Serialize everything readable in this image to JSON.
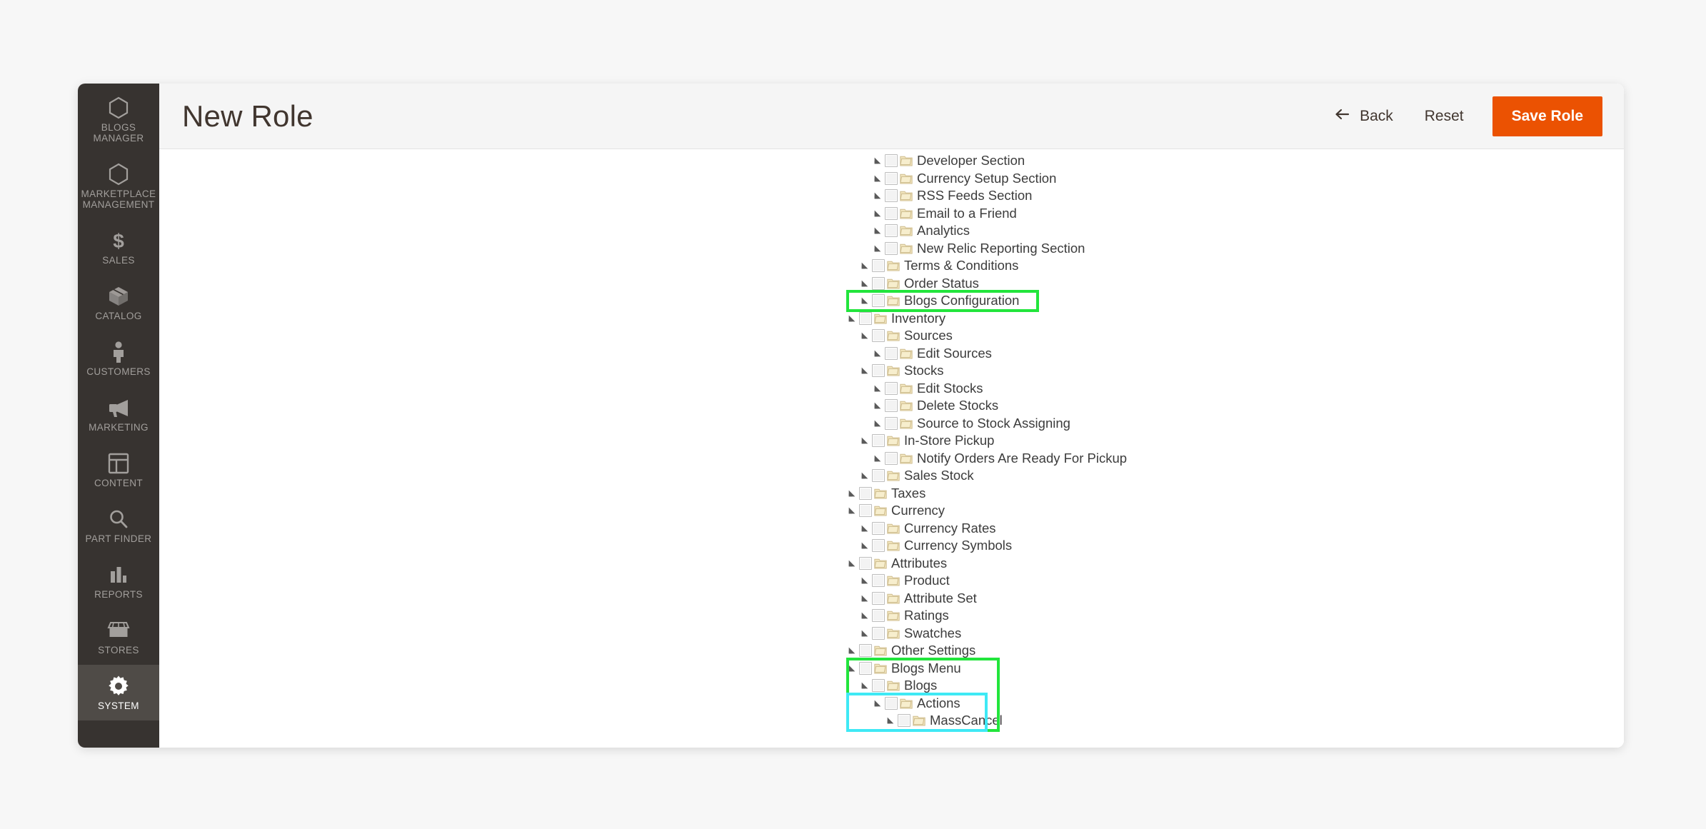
{
  "app": {
    "background_color": "#f7f7f7",
    "accent_color": "#eb5202",
    "sidebar_color": "#373330",
    "highlight_primary_color": "#22e53c",
    "highlight_secondary_color": "#3fe9f5"
  },
  "sidebar": {
    "items": [
      {
        "label": "BLOGS\nMANAGER",
        "icon": "hexagon-icon",
        "active": false
      },
      {
        "label": "MARKETPLACE\nMANAGEMENT",
        "icon": "hexagon-icon",
        "active": false
      },
      {
        "label": "SALES",
        "icon": "dollar-icon",
        "active": false
      },
      {
        "label": "CATALOG",
        "icon": "box-icon",
        "active": false
      },
      {
        "label": "CUSTOMERS",
        "icon": "person-icon",
        "active": false
      },
      {
        "label": "MARKETING",
        "icon": "megaphone-icon",
        "active": false
      },
      {
        "label": "CONTENT",
        "icon": "layout-icon",
        "active": false
      },
      {
        "label": "PART FINDER",
        "icon": "search-icon",
        "active": false
      },
      {
        "label": "REPORTS",
        "icon": "bar-chart-icon",
        "active": false
      },
      {
        "label": "STORES",
        "icon": "storefront-icon",
        "active": false
      },
      {
        "label": "SYSTEM",
        "icon": "gear-icon",
        "active": true
      }
    ]
  },
  "header": {
    "title": "New Role",
    "back_label": "Back",
    "back_icon": "arrow-left-icon",
    "reset_label": "Reset",
    "save_label": "Save Role"
  },
  "tree": {
    "nodes": [
      {
        "label": "Developer Section",
        "level": 3
      },
      {
        "label": "Currency Setup Section",
        "level": 3
      },
      {
        "label": "RSS Feeds Section",
        "level": 3
      },
      {
        "label": "Email to a Friend",
        "level": 3
      },
      {
        "label": "Analytics",
        "level": 3
      },
      {
        "label": "New Relic Reporting Section",
        "level": 3
      },
      {
        "label": "Terms & Conditions",
        "level": 2
      },
      {
        "label": "Order Status",
        "level": 2
      },
      {
        "label": "Blogs Configuration",
        "level": 2
      },
      {
        "label": "Inventory",
        "level": 1
      },
      {
        "label": "Sources",
        "level": 2
      },
      {
        "label": "Edit Sources",
        "level": 3
      },
      {
        "label": "Stocks",
        "level": 2
      },
      {
        "label": "Edit Stocks",
        "level": 3
      },
      {
        "label": "Delete Stocks",
        "level": 3
      },
      {
        "label": "Source to Stock Assigning",
        "level": 3
      },
      {
        "label": "In-Store Pickup",
        "level": 2
      },
      {
        "label": "Notify Orders Are Ready For Pickup",
        "level": 3
      },
      {
        "label": "Sales Stock",
        "level": 2
      },
      {
        "label": "Taxes",
        "level": 1
      },
      {
        "label": "Currency",
        "level": 1
      },
      {
        "label": "Currency Rates",
        "level": 2
      },
      {
        "label": "Currency Symbols",
        "level": 2
      },
      {
        "label": "Attributes",
        "level": 1
      },
      {
        "label": "Product",
        "level": 2
      },
      {
        "label": "Attribute Set",
        "level": 2
      },
      {
        "label": "Ratings",
        "level": 2
      },
      {
        "label": "Swatches",
        "level": 2
      },
      {
        "label": "Other Settings",
        "level": 1
      },
      {
        "label": "Blogs Menu",
        "level": 1
      },
      {
        "label": "Blogs",
        "level": 2
      },
      {
        "label": "Actions",
        "level": 3
      },
      {
        "label": "MassCancel",
        "level": 4
      }
    ]
  },
  "annotations": [
    {
      "name": "blogs-configuration-highlight",
      "color": "#22e53c",
      "target": "Blogs Configuration"
    },
    {
      "name": "blogs-menu-highlight",
      "color": "#22e53c",
      "target": "Blogs Menu"
    },
    {
      "name": "actions-masscancel-highlight",
      "color": "#3fe9f5",
      "target": "Actions / MassCancel"
    }
  ]
}
